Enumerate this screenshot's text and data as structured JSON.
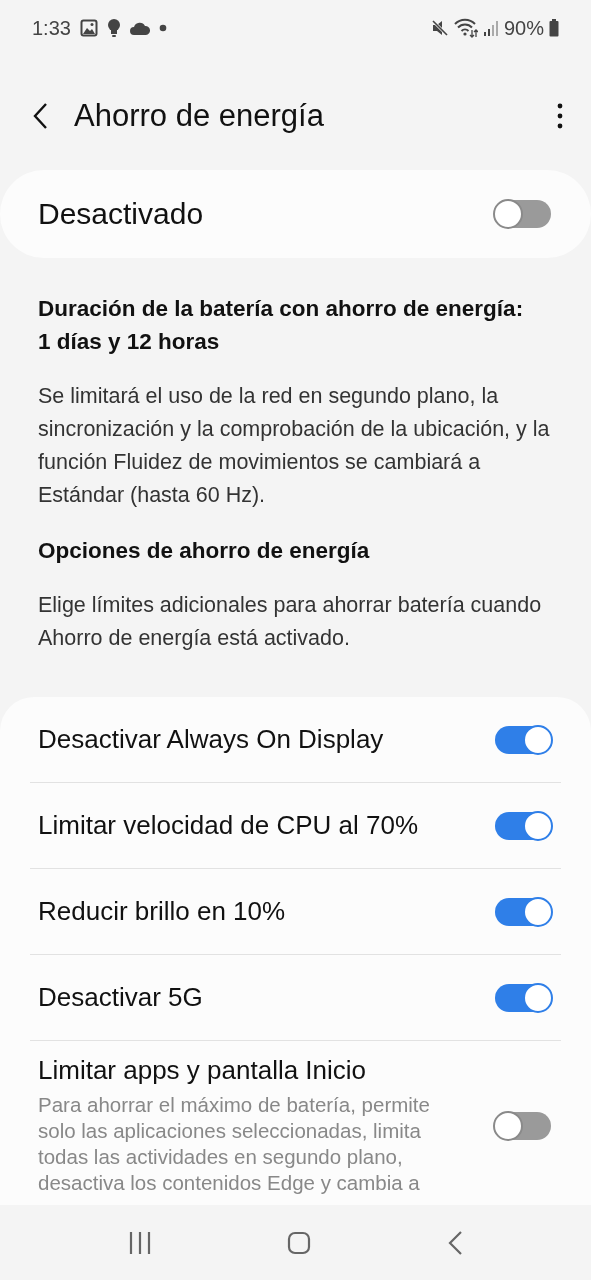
{
  "status_bar": {
    "time": "1:33",
    "battery": "90%"
  },
  "header": {
    "title": "Ahorro de energía"
  },
  "master": {
    "label": "Desactivado",
    "on": false
  },
  "duration": {
    "title": "Duración de la batería con ahorro de energía:",
    "value": "1 días y 12 horas"
  },
  "description": "Se limitará el uso de la red en segundo plano, la sincronización y la comprobación de la ubicación, y la función Fluidez de movimientos se cambiará a Estándar (hasta 60 Hz).",
  "options_heading": "Opciones de ahorro de energía",
  "options_description": "Elige límites adicionales para ahorrar batería cuando Ahorro de energía está activado.",
  "options": [
    {
      "label": "Desactivar Always On Display",
      "on": true
    },
    {
      "label": "Limitar velocidad de CPU al 70%",
      "on": true
    },
    {
      "label": "Reducir brillo en 10%",
      "on": true
    },
    {
      "label": "Desactivar 5G",
      "on": true
    },
    {
      "label": "Limitar apps y pantalla Inicio",
      "summary": "Para ahorrar el máximo de batería, permite solo las aplicaciones seleccionadas, limita todas las actividades en segundo plano, desactiva los contenidos Edge y cambia a",
      "on": false
    }
  ]
}
